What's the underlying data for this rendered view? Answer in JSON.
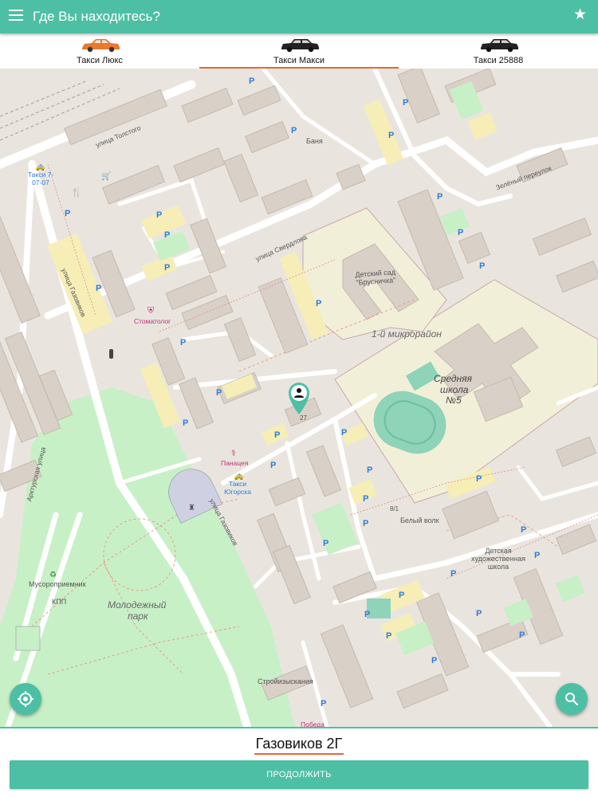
{
  "appbar": {
    "title": "Где Вы находитесь?",
    "menu_icon": "hamburger-menu-icon",
    "star_icon": "star-icon"
  },
  "tabs": [
    {
      "label": "Такси Люкс",
      "car_color": "#e8792e",
      "active": false
    },
    {
      "label": "Такси Макси",
      "car_color": "#222222",
      "active": true
    },
    {
      "label": "Такси 25888",
      "car_color": "#222222",
      "active": false
    }
  ],
  "map": {
    "labels": {
      "street_tolstogo": "улица Толстого",
      "street_sverdlova": "улица Свердлова",
      "street_gazovikov_1": "улица Газовиков",
      "street_gazovikov_2": "улица Газовиков",
      "street_arktur": "Арктурская улица",
      "street_zeleny": "Зелёный переулок",
      "kindergarten": "Детский сад \"Брусничка\"",
      "district": "1-й микрорайон",
      "school_1": "Средняя",
      "school_2": "школа",
      "school_3": "№5",
      "park_1": "Молодежный",
      "park_2": "парк",
      "art_school": "Детская художественная школа",
      "belyi_volk": "Белый волк",
      "stroy": "Стройизыскания",
      "banya": "Баня",
      "musor": "Мусороприемник",
      "kpp": "КПП",
      "stomatolog": "Стоматолог",
      "panaceya": "Панацея",
      "taxi_1": "Такси 7-07-07",
      "taxi_2": "Такси Югорска",
      "pobeda": "Победа",
      "num_27": "27",
      "num_8_1": "8/1"
    }
  },
  "fabs": {
    "locate_icon": "my-location-icon",
    "search_icon": "search-icon"
  },
  "bottom": {
    "address": "Газовиков 2Г",
    "continue_label": "ПРОДОЛЖИТЬ"
  },
  "colors": {
    "accent": "#4dbfa5",
    "underline": "#e8663a",
    "park": "#c8f0c7",
    "building": "#d9d0c8",
    "school_area": "#f2efd9",
    "parking": "#f6eeb6"
  }
}
